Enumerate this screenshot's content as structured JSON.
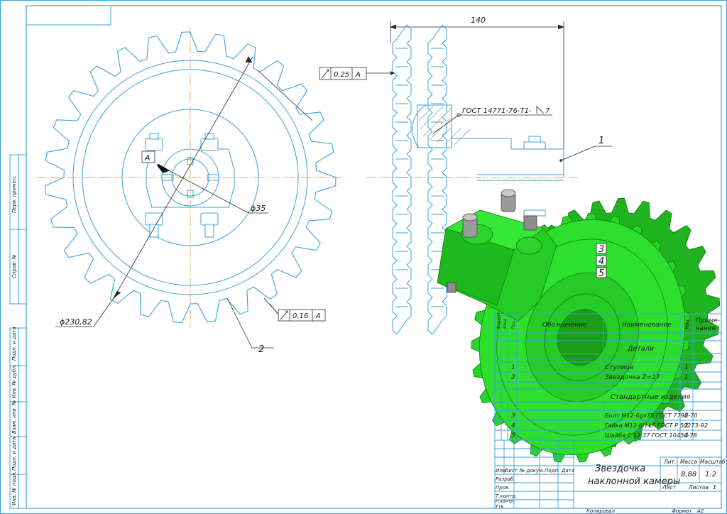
{
  "view_front": {
    "diameter_outer": "ϕ230,82",
    "diameter_bore": "ϕ35",
    "datum_label": "A",
    "leader_2": "2",
    "runout": {
      "value": "0,16",
      "datum": "A"
    }
  },
  "view_side": {
    "width_dim": "140",
    "runout": {
      "value": "0,25",
      "datum": "A"
    },
    "weld_note": "ГОСТ 14771-76-Т1-",
    "weld_leg": "7",
    "leader_1": "1"
  },
  "model_3d": {
    "callouts": [
      "3",
      "4",
      "5"
    ],
    "color": "#28d428"
  },
  "spec_table": {
    "header": {
      "format_col": "Формат",
      "zone_col": "Зона",
      "pos_col": "Поз.",
      "designation": "Обозначение",
      "name": "Наименование",
      "qty": "Кол.",
      "note_line1": "Приме-",
      "note_line2": "чание"
    },
    "section_details": "Детали",
    "section_standard": "Стандартные изделия",
    "rows": [
      {
        "pos": "1",
        "name": "Ступица",
        "qty": "1"
      },
      {
        "pos": "2",
        "name": "Звездочка Z=27",
        "qty": "1"
      },
      {
        "pos": "3",
        "name": "Болт М12-6gх75 ГОСТ 7796-70",
        "qty": "2"
      },
      {
        "pos": "4",
        "name": "Гайка М12-6Н.LF ГОСТ Р 50273-92",
        "qty": "2"
      },
      {
        "pos": "5",
        "name": "Шайба С 12.37 ГОСТ 10450-78",
        "qty": "4"
      }
    ]
  },
  "title_block": {
    "title_line1": "Звездочка",
    "title_line2": "наклонной камеры",
    "lit_label": "Лит.",
    "mass_label": "Масса",
    "scale_label": "Масштаб",
    "mass_value": "8,88",
    "scale_value": "1:2",
    "sheet_label": "Лист",
    "sheets_label": "Листов",
    "sheets_value": "1",
    "change_cols": [
      "Изм.",
      "Лист",
      "№ докум.",
      "Подп.",
      "Дата"
    ],
    "roles": [
      "Разраб.",
      "Пров.",
      "Т.контр.",
      "Н.контр.",
      "Утв."
    ]
  },
  "footer": {
    "copied": "Копировал",
    "format_label": "Формат",
    "format_value": "А2"
  },
  "side_stamps": [
    "Перв. примен.",
    "Справ. №",
    "Подп. и дата",
    "Инв. № дубл.",
    "Взам. инв. №",
    "Подп. и дата",
    "Инв. № подл."
  ],
  "colors": {
    "line": "#3aa0de",
    "dim": "#2a2a2a",
    "axis": "#d88a3a",
    "green": "#28d428",
    "green_dark": "#189018"
  }
}
